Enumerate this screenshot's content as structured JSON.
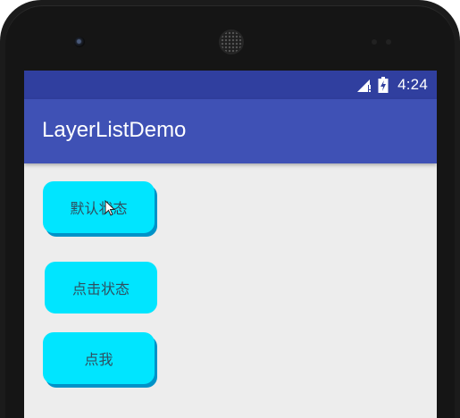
{
  "status_bar": {
    "time": "4:24",
    "icons": [
      "signal-icon",
      "battery-charging-icon"
    ],
    "background": "#303f9f"
  },
  "app_bar": {
    "title": "LayerListDemo",
    "background": "#3f51b5"
  },
  "buttons": {
    "default_state": "默认状态",
    "pressed_state": "点击状态",
    "click_me": "点我"
  },
  "colors": {
    "button_fill": "#00e5ff",
    "button_shadow": "#0092c8",
    "content_background": "#ededed"
  }
}
